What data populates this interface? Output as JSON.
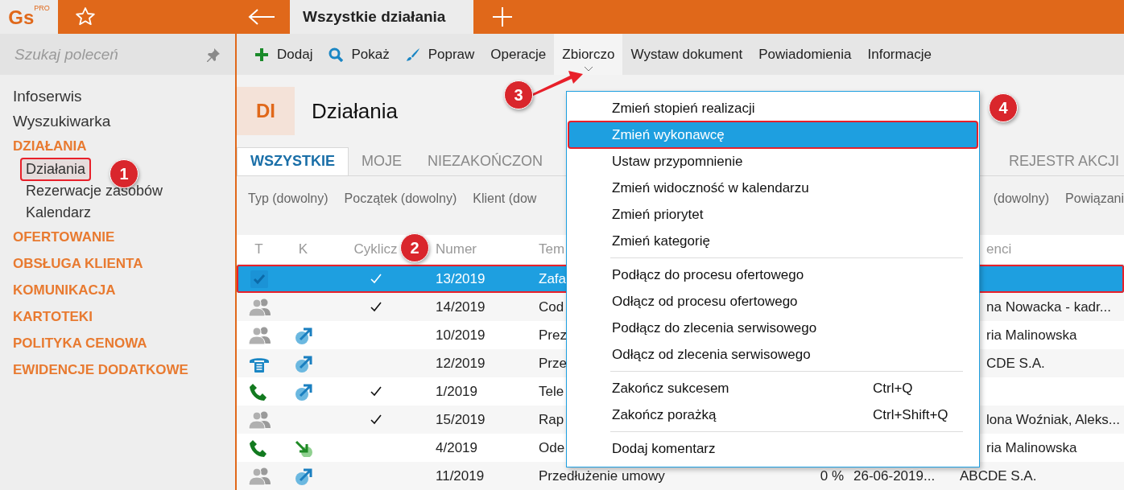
{
  "app": {
    "logo": "Gs",
    "logo_badge": "PRO"
  },
  "tabs": [
    {
      "label": "Wszystkie działania",
      "selected": true
    }
  ],
  "sidebar": {
    "search": {
      "placeholder": "Szukaj poleceń"
    },
    "items": [
      {
        "kind": "link",
        "label": "Infoserwis",
        "selected": false
      },
      {
        "kind": "link",
        "label": "Wyszukiwarka",
        "selected": false
      },
      {
        "kind": "section",
        "label": "DZIAŁANIA",
        "selected": false
      },
      {
        "kind": "sub",
        "label": "Działania",
        "selected": true
      },
      {
        "kind": "sub",
        "label": "Rezerwacje zasobów",
        "selected": false
      },
      {
        "kind": "sub",
        "label": "Kalendarz",
        "selected": false
      },
      {
        "kind": "section",
        "label": "OFERTOWANIE",
        "selected": false
      },
      {
        "kind": "section",
        "label": "OBSŁUGA KLIENTA",
        "selected": false
      },
      {
        "kind": "section",
        "label": "KOMUNIKACJA",
        "selected": false
      },
      {
        "kind": "section",
        "label": "KARTOTEKI",
        "selected": false
      },
      {
        "kind": "section",
        "label": "POLITYKA CENOWA",
        "selected": false
      },
      {
        "kind": "section",
        "label": "EWIDENCJE DODATKOWE",
        "selected": false
      }
    ]
  },
  "toolbar": [
    {
      "kind": "add",
      "label": "Dodaj",
      "open": false
    },
    {
      "kind": "search",
      "label": "Pokaż",
      "open": false
    },
    {
      "kind": "edit",
      "label": "Popraw",
      "open": false
    },
    {
      "kind": "text",
      "label": "Operacje",
      "open": false
    },
    {
      "kind": "dropdown",
      "label": "Zbiorczo",
      "open": true
    },
    {
      "kind": "text",
      "label": "Wystaw dokument",
      "open": false
    },
    {
      "kind": "text",
      "label": "Powiadomienia",
      "open": false
    },
    {
      "kind": "text",
      "label": "Informacje",
      "open": false
    }
  ],
  "header": {
    "badge": "DI",
    "title": "Działania"
  },
  "view_tabs": {
    "left": [
      {
        "label": "WSZYSTKIE",
        "selected": true
      },
      {
        "label": "MOJE",
        "selected": false
      },
      {
        "label": "NIEZAKOŃCZON",
        "selected": false
      }
    ],
    "right": [
      {
        "label": "REJESTR AKCJI",
        "selected": false
      }
    ]
  },
  "filters": {
    "left": [
      "Typ (dowolny)",
      "Początek (dowolny)",
      "Klient (dow"
    ],
    "right": [
      "(dowolny)",
      "Powiązani"
    ]
  },
  "table": {
    "columns": [
      "T",
      "K",
      "Cyklicz",
      "Numer",
      "Tem",
      "enci"
    ],
    "rows": [
      {
        "type_icon": {
          "kind": "check"
        },
        "cyclic": true,
        "number": "13/2019",
        "subject": "Zafa",
        "selected": true
      },
      {
        "type_icon": {
          "kind": "group"
        },
        "cyclic": true,
        "number": "14/2019",
        "subject": "Cod",
        "recipients": "na Nowacka - kadr...",
        "selected": false
      },
      {
        "type_icon": {
          "kind": "group"
        },
        "direction_icon": {
          "kind": "out"
        },
        "cyclic": false,
        "number": "10/2019",
        "subject": "Prez",
        "recipients": "ria Malinowska",
        "selected": false
      },
      {
        "type_icon": {
          "kind": "deskphone"
        },
        "direction_icon": {
          "kind": "out"
        },
        "cyclic": false,
        "number": "12/2019",
        "subject": "Prze",
        "recipients": "CDE S.A.",
        "selected": false
      },
      {
        "type_icon": {
          "kind": "phone"
        },
        "direction_icon": {
          "kind": "out"
        },
        "cyclic": true,
        "number": "1/2019",
        "subject": "Tele",
        "selected": false
      },
      {
        "type_icon": {
          "kind": "group"
        },
        "cyclic": true,
        "number": "15/2019",
        "subject": "Rap",
        "recipients": "lona Woźniak, Aleks...",
        "selected": false
      },
      {
        "type_icon": {
          "kind": "phone"
        },
        "direction_icon": {
          "kind": "in"
        },
        "cyclic": false,
        "number": "4/2019",
        "subject": "Ode",
        "recipients": "ria Malinowska",
        "selected": false
      },
      {
        "type_icon": {
          "kind": "group"
        },
        "direction_icon": {
          "kind": "out"
        },
        "cyclic": false,
        "number": "11/2019",
        "subject": "Przedłużenie umowy",
        "percent": "0 %",
        "date": "26-06-2019...",
        "recipients": "ABCDE S.A.",
        "selected": false
      }
    ]
  },
  "menu": {
    "items": [
      {
        "kind": "item",
        "label": "Zmień stopień realizacji",
        "selected": false
      },
      {
        "kind": "item",
        "label": "Zmień wykonawcę",
        "selected": true
      },
      {
        "kind": "item",
        "label": "Ustaw przypomnienie",
        "selected": false
      },
      {
        "kind": "item",
        "label": "Zmień widoczność w kalendarzu",
        "selected": false
      },
      {
        "kind": "item",
        "label": "Zmień priorytet",
        "selected": false
      },
      {
        "kind": "item",
        "label": "Zmień kategorię",
        "selected": false
      },
      {
        "kind": "separator"
      },
      {
        "kind": "item",
        "label": "Podłącz do procesu ofertowego",
        "selected": false
      },
      {
        "kind": "item",
        "label": "Odłącz od procesu ofertowego",
        "selected": false
      },
      {
        "kind": "item",
        "label": "Podłącz do zlecenia serwisowego",
        "selected": false
      },
      {
        "kind": "item",
        "label": "Odłącz od zlecenia serwisowego",
        "selected": false
      },
      {
        "kind": "separator"
      },
      {
        "kind": "item",
        "label": "Zakończ sukcesem",
        "shortcut": "Ctrl+Q",
        "selected": false
      },
      {
        "kind": "item",
        "label": "Zakończ porażką",
        "shortcut": "Ctrl+Shift+Q",
        "selected": false
      },
      {
        "kind": "separator"
      },
      {
        "kind": "item",
        "label": "Dodaj komentarz",
        "selected": false
      }
    ]
  },
  "highlights": [
    {
      "kind": "sidebar"
    },
    {
      "kind": "table"
    },
    {
      "kind": "menu"
    }
  ],
  "callouts": [
    {
      "kind": "sidebar",
      "label": "1"
    },
    {
      "kind": "table",
      "label": "2"
    },
    {
      "kind": "toolbar",
      "label": "3"
    },
    {
      "kind": "menu",
      "label": "4"
    }
  ]
}
